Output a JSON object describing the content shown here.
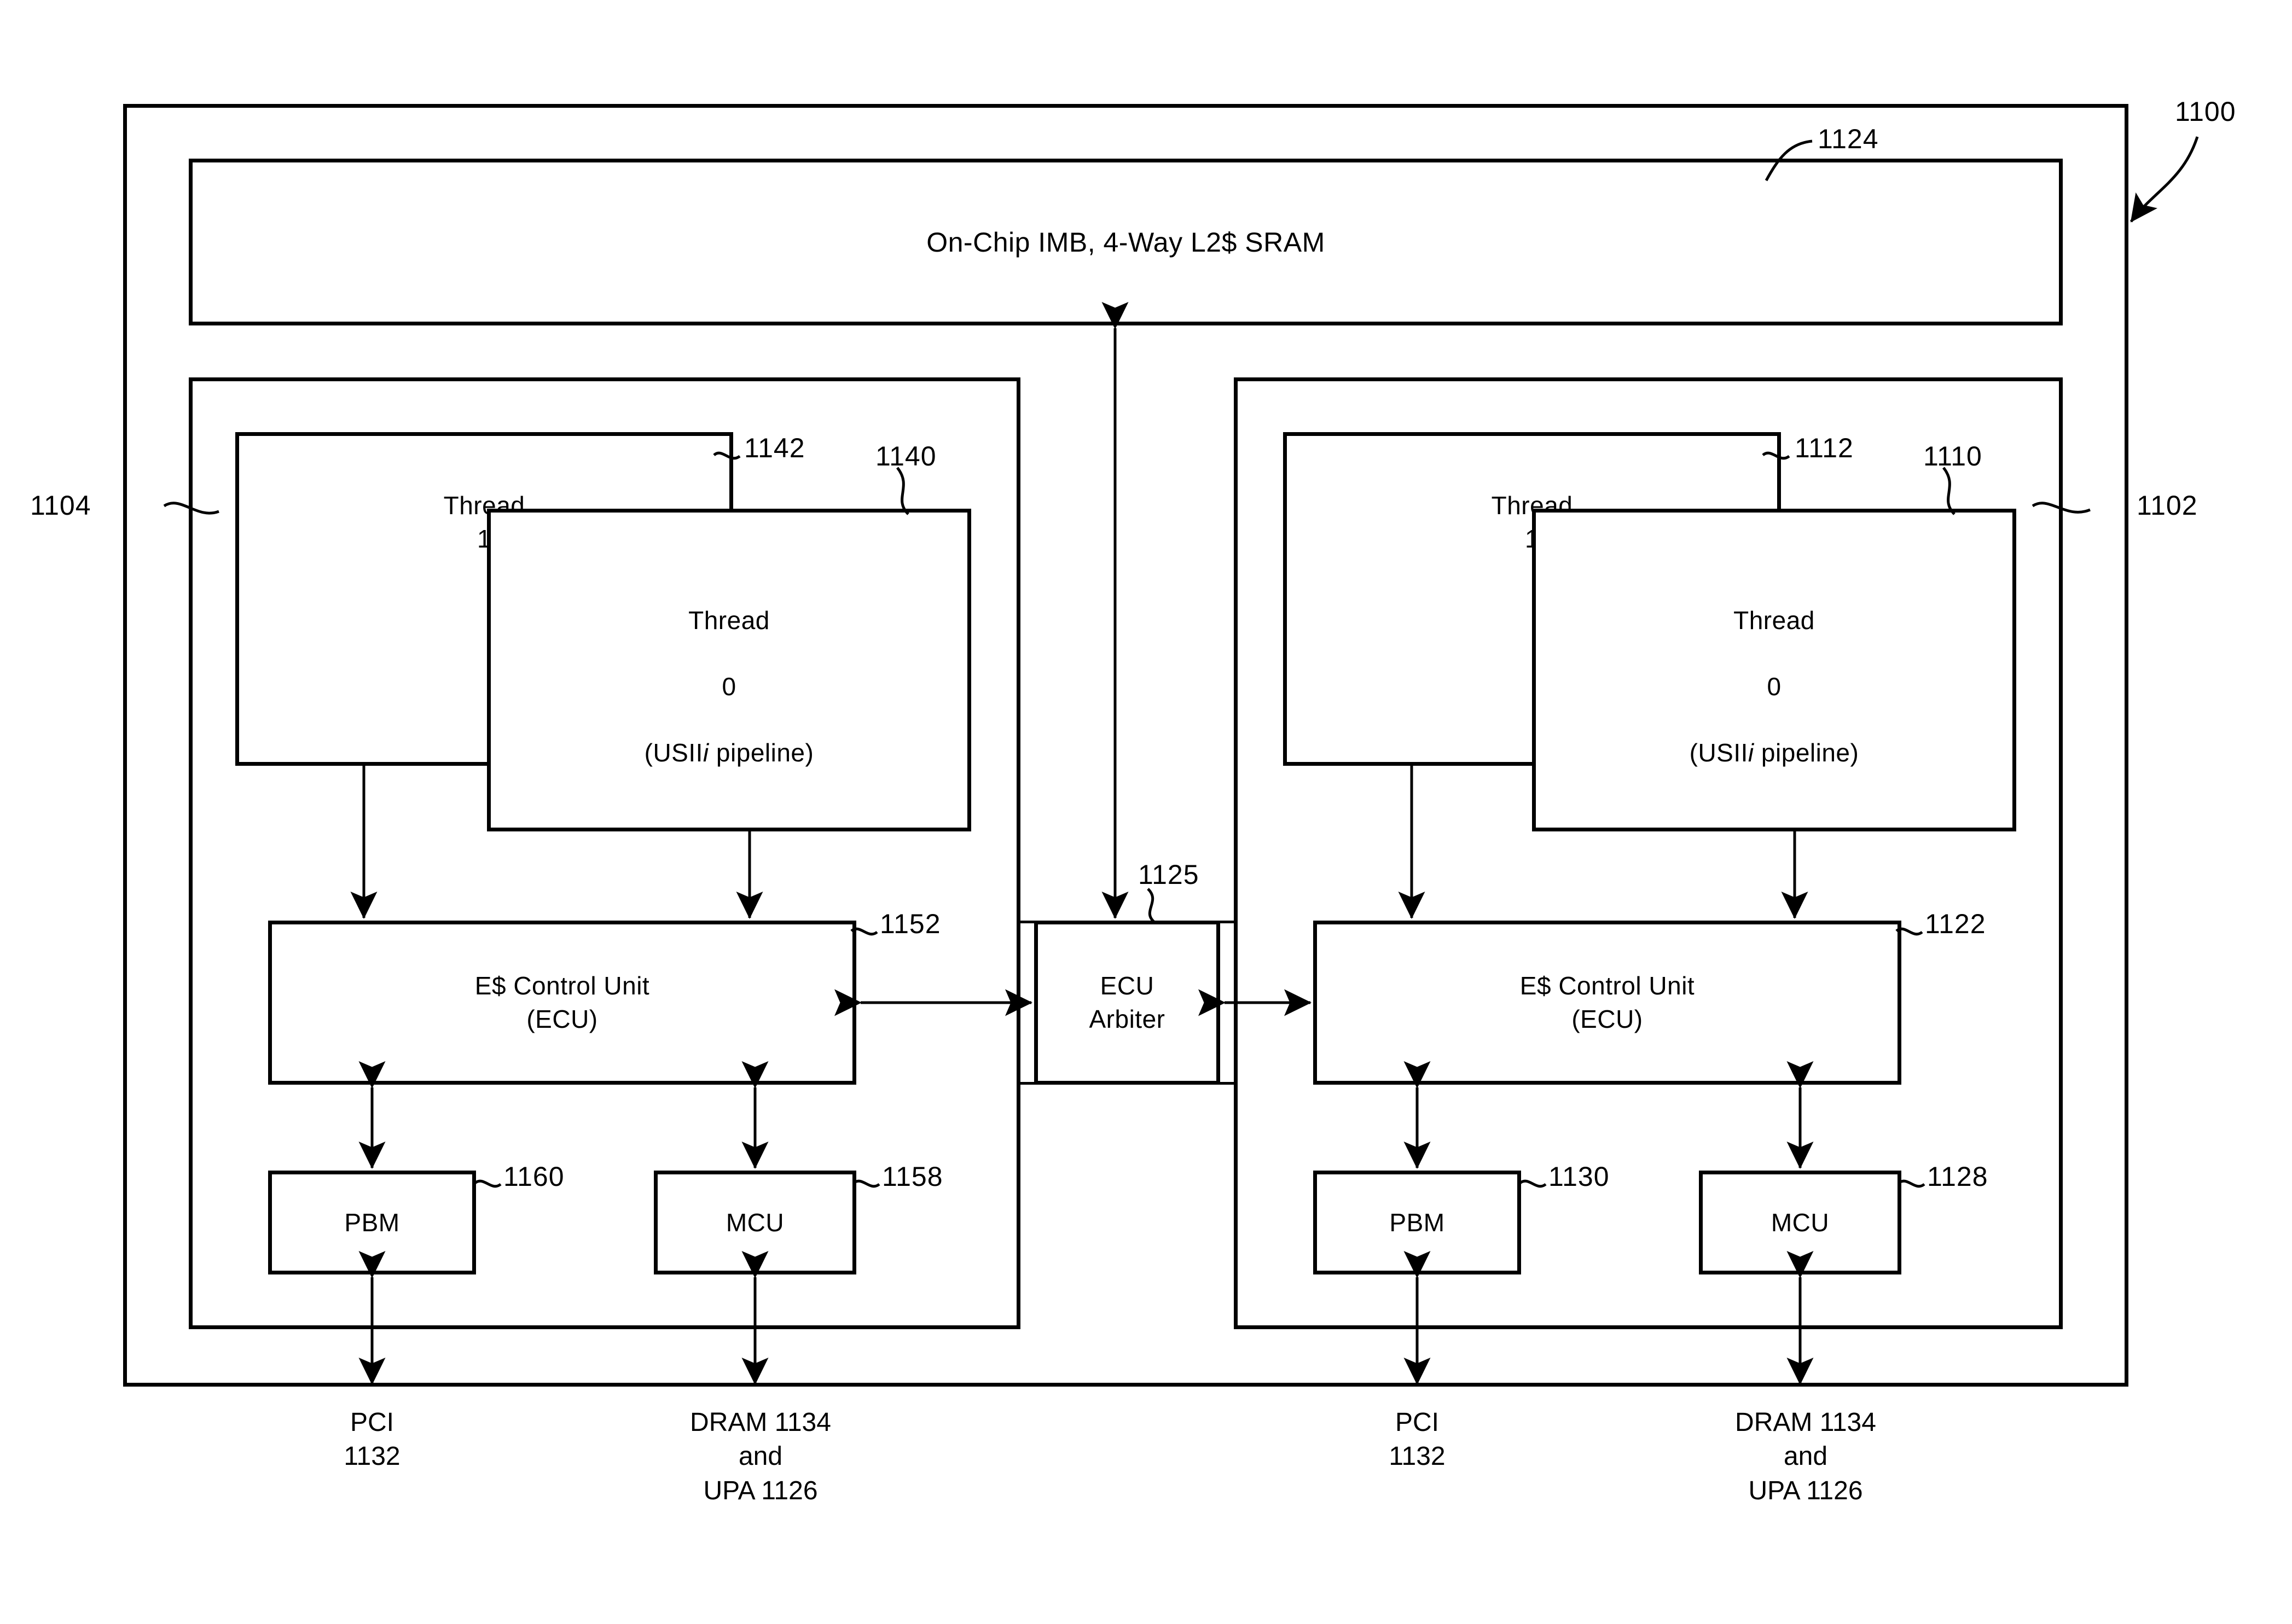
{
  "figure": {
    "number": "1100",
    "outer_ref": "1100",
    "shared_cache": {
      "label": "On-Chip IMB, 4-Way L2$ SRAM",
      "ref": "1124"
    },
    "interconnect": {
      "label": "ECU\nArbiter",
      "ref": "1125"
    },
    "processors": [
      {
        "side": "left",
        "ref": "1104",
        "thread1": {
          "label": "Thread\n1",
          "ref": "1142"
        },
        "thread0": {
          "label_line1": "Thread",
          "label_line2": "0",
          "label_line3_pre": "(USII",
          "label_line3_ital": "i",
          "label_line3_post": " pipeline)",
          "ref": "1140"
        },
        "ecu": {
          "label": "E$ Control Unit\n(ECU)",
          "ref": "1152"
        },
        "pbm": {
          "label": "PBM",
          "ref": "1160"
        },
        "mcu": {
          "label": "MCU",
          "ref": "1158"
        },
        "bus_pci": "PCI\n1132",
        "bus_mem": "DRAM 1134\nand\nUPA 1126"
      },
      {
        "side": "right",
        "ref": "1102",
        "thread1": {
          "label": "Thread\n1",
          "ref": "1112"
        },
        "thread0": {
          "label_line1": "Thread",
          "label_line2": "0",
          "label_line3_pre": "(USII",
          "label_line3_ital": "i",
          "label_line3_post": " pipeline)",
          "ref": "1110"
        },
        "ecu": {
          "label": "E$ Control Unit\n(ECU)",
          "ref": "1122"
        },
        "pbm": {
          "label": "PBM",
          "ref": "1130"
        },
        "mcu": {
          "label": "MCU",
          "ref": "1128"
        },
        "bus_pci": "PCI\n1132",
        "bus_mem": "DRAM 1134\nand\nUPA 1126"
      }
    ],
    "colors": {
      "line": "#000000",
      "background": "#ffffff"
    }
  }
}
